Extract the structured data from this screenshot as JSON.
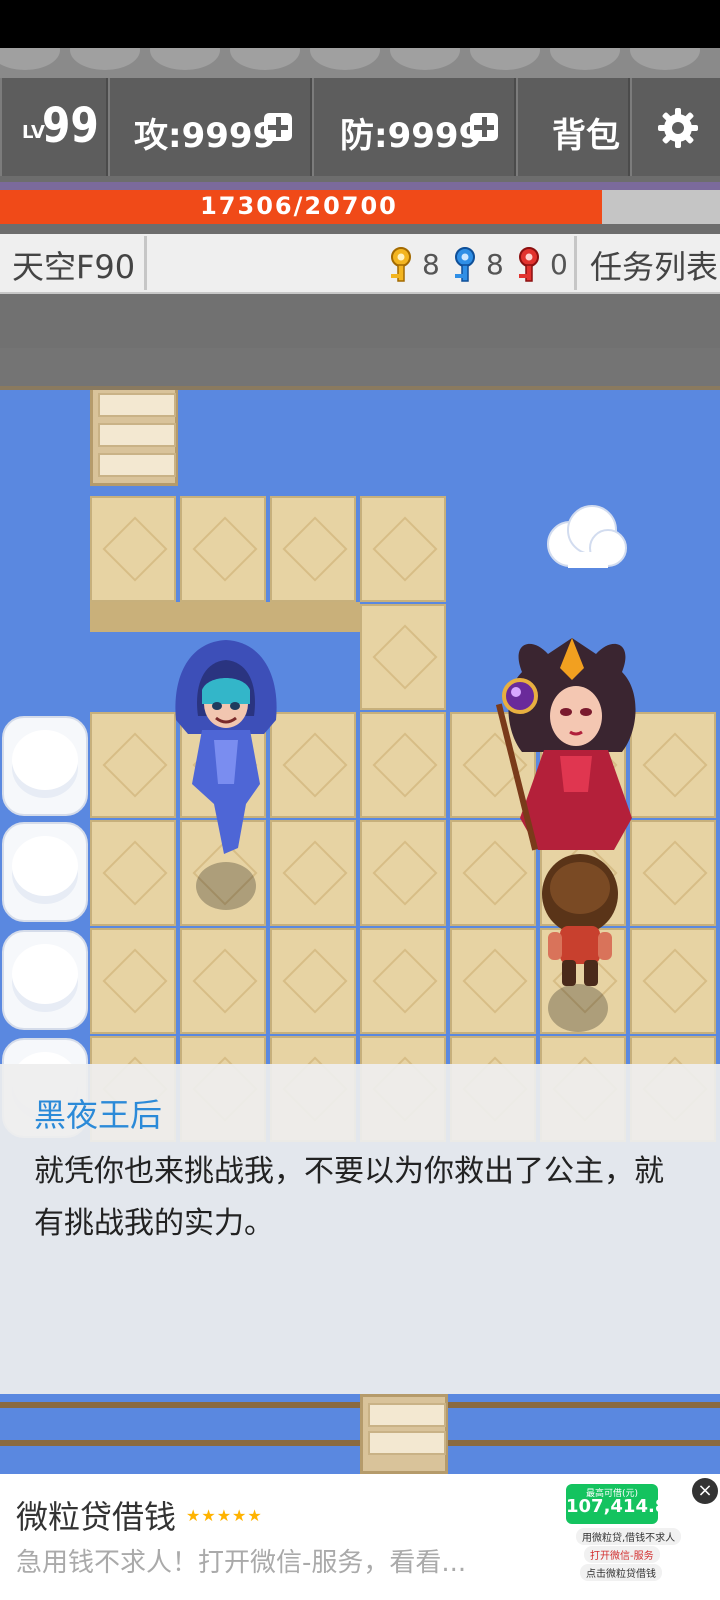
{
  "hud": {
    "level_prefix": "LV",
    "level": "99",
    "attack": "攻:9999",
    "defense": "防:9999",
    "bag": "背包",
    "hp": "17306/20700",
    "hp_fraction": 0.836,
    "floor": "天空F90",
    "keys": {
      "yellow": "8",
      "blue": "8",
      "red": "0"
    },
    "quest_list": "任务列表"
  },
  "colors": {
    "hp_fill": "#f04a18",
    "speaker_name": "#2b8ad8",
    "water": "#5a88e0",
    "ad_green": "#14c35f"
  },
  "dialog": {
    "speaker": "黑夜王后",
    "message": "就凭你也来挑战我，不要以为你救出了公主，就有挑战我的实力。"
  },
  "ad": {
    "title": "微粒贷借钱",
    "stars": "★★★★★",
    "description": "急用钱不求人！打开微信-服务，看看...",
    "amount_label": "最高可借(元)",
    "amount": "107,414.83",
    "line1": "用微粒贷,借钱不求人",
    "line2": "打开微信-服务",
    "line3": "点击微粒贷借钱",
    "close": "×"
  },
  "icons": {
    "settings": "gear-icon",
    "yellow_key": "yellow-key-icon",
    "blue_key": "blue-key-icon",
    "red_key": "red-key-icon"
  }
}
